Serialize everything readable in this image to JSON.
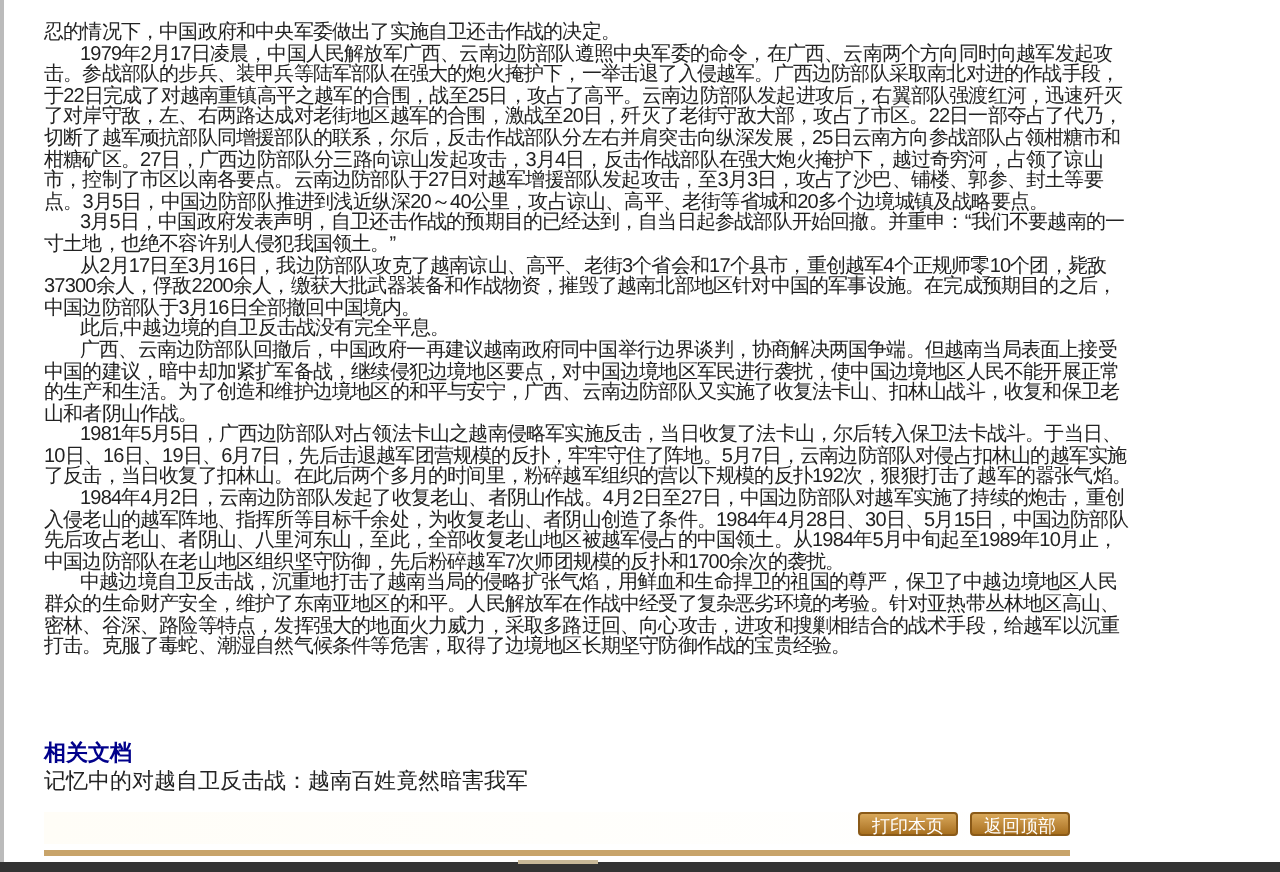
{
  "article": {
    "paragraphs": [
      {
        "text": "忍的情况下，中国政府和中央军委做出了实施自卫还击作战的决定。",
        "indent": false
      },
      {
        "text": "1979年2月17日凌晨，中国人民解放军广西、云南边防部队遵照中央军委的命令，在广西、云南两个方向同时向越军发起攻击。参战部队的步兵、装甲兵等陆军部队在强大的炮火掩护下，一举击退了入侵越军。广西边防部队采取南北对进的作战手段，于22日完成了对越南重镇高平之越军的合围，战至25日，攻占了高平。云南边防部队发起进攻后，右翼部队强渡红河，迅速歼灭了对岸守敌，左、右两路达成对老街地区越军的合围，激战至20日，歼灭了老街守敌大部，攻占了市区。22日一部夺占了代乃，切断了越军顽抗部队同增援部队的联系，尔后，反击作战部队分左右并肩突击向纵深发展，25日云南方向参战部队占领柑糖市和柑糖矿区。27日，广西边防部队分三路向谅山发起攻击，3月4日，反击作战部队在强大炮火掩护下，越过奇穷河，占领了谅山市，控制了市区以南各要点。云南边防部队于27日对越军增援部队发起攻击，至3月3日，攻占了沙巴、铺楼、郭参、封土等要点。3月5日，中国边防部队推进到浅近纵深20～40公里，攻占谅山、高平、老街等省城和20多个边境城镇及战略要点。",
        "indent": true
      },
      {
        "text": "3月5日，中国政府发表声明，自卫还击作战的预期目的已经达到，自当日起参战部队开始回撤。并重申：“我们不要越南的一寸土地，也绝不容许别人侵犯我国领土。”",
        "indent": true
      },
      {
        "text": "从2月17日至3月16日，我边防部队攻克了越南谅山、高平、老街3个省会和17个县市，重创越军4个正规师零10个团，毙敌37300余人，俘敌2200余人，缴获大批武器装备和作战物资，摧毁了越南北部地区针对中国的军事设施。在完成预期目的之后，中国边防部队于3月16日全部撤回中国境内。",
        "indent": true
      },
      {
        "text": "此后,中越边境的自卫反击战没有完全平息。",
        "indent": true
      },
      {
        "text": "广西、云南边防部队回撤后，中国政府一再建议越南政府同中国举行边界谈判，协商解决两国争端。但越南当局表面上接受中国的建议，暗中却加紧扩军备战，继续侵犯边境地区要点，对中国边境地区军民进行袭扰，使中国边境地区人民不能开展正常的生产和生活。为了创造和维护边境地区的和平与安宁，广西、云南边防部队又实施了收复法卡山、扣林山战斗，收复和保卫老山和者阴山作战。",
        "indent": true
      },
      {
        "text": "1981年5月5日，广西边防部队对占领法卡山之越南侵略军实施反击，当日收复了法卡山，尔后转入保卫法卡战斗。于当日、10日、16日、19日、6月7日，先后击退越军团营规模的反扑，牢牢守住了阵地。5月7日，云南边防部队对侵占扣林山的越军实施了反击，当日收复了扣林山。在此后两个多月的时间里，粉碎越军组织的营以下规模的反扑192次，狠狠打击了越军的嚣张气焰。",
        "indent": true
      },
      {
        "text": "1984年4月2日，云南边防部队发起了收复老山、者阴山作战。4月2日至27日，中国边防部队对越军实施了持续的炮击，重创入侵老山的越军阵地、指挥所等目标千余处，为收复老山、者阴山创造了条件。1984年4月28日、30日、5月15日，中国边防部队先后攻占老山、者阴山、八里河东山，至此，全部收复老山地区被越军侵占的中国领土。从1984年5月中旬起至1989年10月止，中国边防部队在老山地区组织坚守防御，先后粉碎越军7次师团规模的反扑和1700余次的袭扰。",
        "indent": true
      },
      {
        "text": "中越边境自卫反击战，沉重地打击了越南当局的侵略扩张气焰，用鲜血和生命捍卫的祖国的尊严，保卫了中越边境地区人民群众的生命财产安全，维护了东南亚地区的和平。人民解放军在作战中经受了复杂恶劣环境的考验。针对亚热带丛林地区高山、密林、谷深、路险等特点，发挥强大的地面火力威力，采取多路迂回、向心攻击，进攻和搜剿相结合的战术手段，给越军以沉重打击。克服了毒蛇、潮湿自然气候条件等危害，取得了边境地区长期坚守防御作战的宝贵经验。",
        "indent": true
      }
    ]
  },
  "related": {
    "heading": "相关文档",
    "links": [
      "记忆中的对越自卫反击战：越南百姓竟然暗害我军"
    ]
  },
  "buttons": [
    "打印本页",
    "返回顶部"
  ]
}
